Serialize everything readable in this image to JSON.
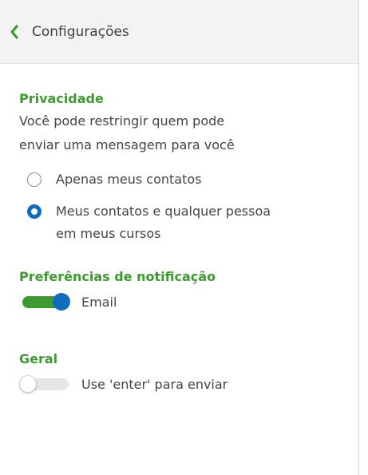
{
  "header": {
    "title": "Configurações",
    "back_icon": "chevron-left-icon"
  },
  "privacy": {
    "title": "Privacidade",
    "description_line1": "Você pode restringir quem pode",
    "description_line2": "enviar uma mensagem para você",
    "options": [
      {
        "label": "Apenas meus contatos",
        "checked": false
      },
      {
        "label_line1": "Meus contatos e qualquer pessoa",
        "label_line2": "em meus cursos",
        "checked": true
      }
    ]
  },
  "notifications": {
    "title": "Preferências de notificação",
    "email_label": "Email",
    "email_enabled": true
  },
  "general": {
    "title": "Geral",
    "enter_label": "Use 'enter' para enviar",
    "enter_enabled": false
  },
  "colors": {
    "accent_green": "#3d9a2f",
    "accent_blue": "#0f6cbf",
    "header_bg": "#f3f3f3"
  }
}
